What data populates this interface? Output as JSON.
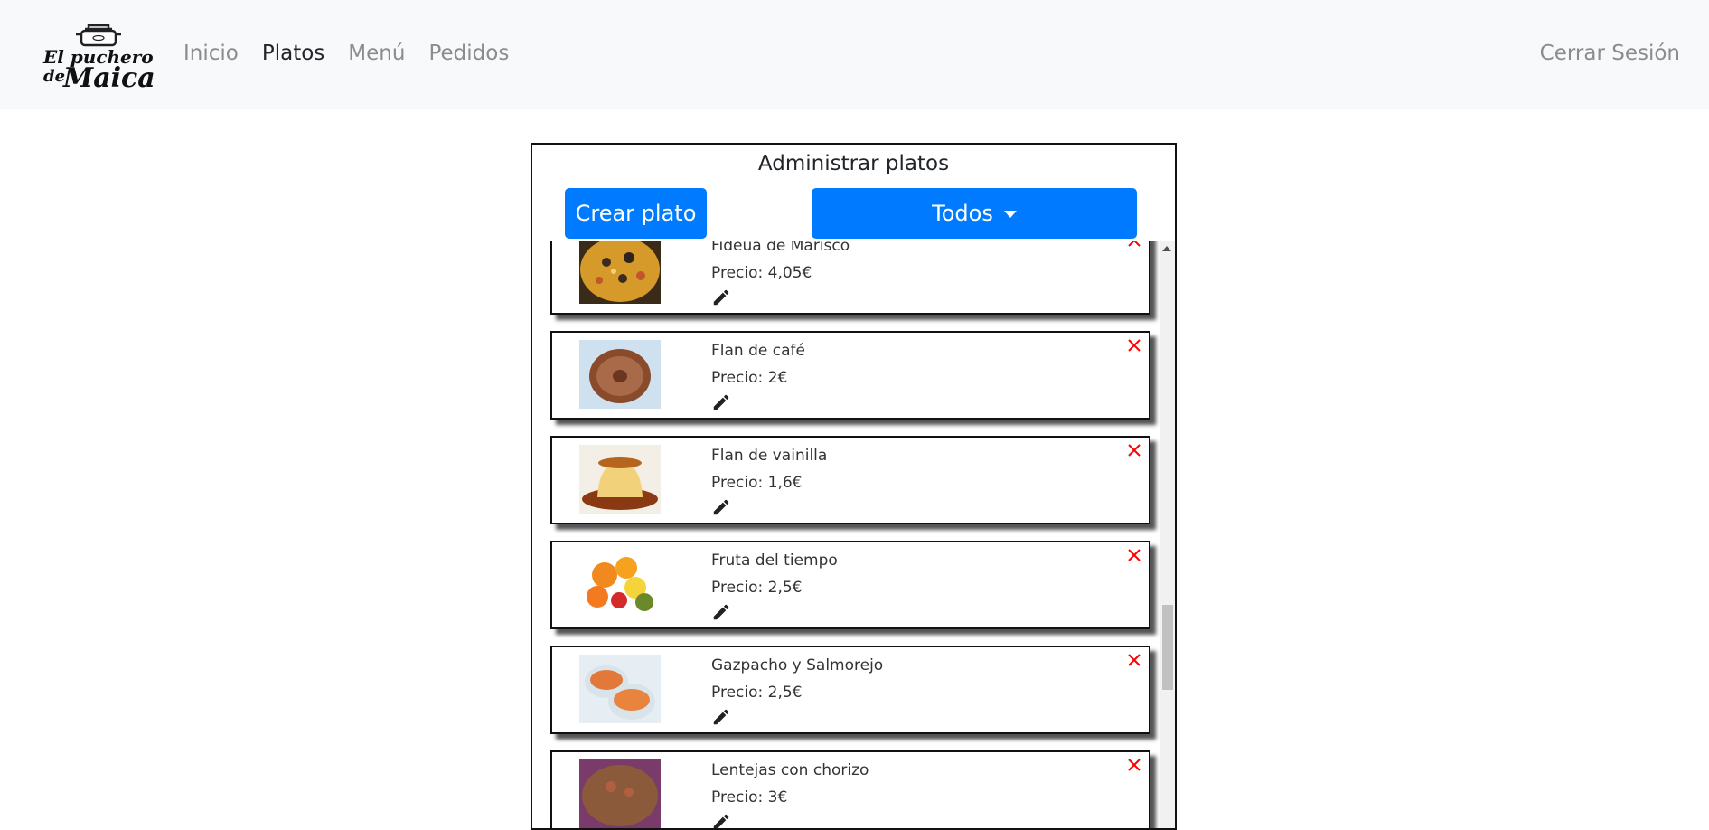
{
  "brand": {
    "logo_text": "El puchero de Maica"
  },
  "nav": {
    "links": [
      "Inicio",
      "Platos",
      "Menú",
      "Pedidos"
    ],
    "active": "Platos",
    "logout": "Cerrar Sesión"
  },
  "panel": {
    "title": "Administrar platos",
    "create_button": "Crear plato",
    "filter_button": "Todos"
  },
  "dishes": [
    {
      "name": "Fideua de Marisco",
      "price_label": "Precio:",
      "price": "4,05€"
    },
    {
      "name": "Flan de café",
      "price_label": "Precio:",
      "price": "2€"
    },
    {
      "name": "Flan de vainilla",
      "price_label": "Precio:",
      "price": "1,6€"
    },
    {
      "name": "Fruta del tiempo",
      "price_label": "Precio:",
      "price": "2,5€"
    },
    {
      "name": "Gazpacho y Salmorejo",
      "price_label": "Precio:",
      "price": "2,5€"
    },
    {
      "name": "Lentejas con chorizo",
      "price_label": "Precio:",
      "price": "3€"
    }
  ],
  "icons": {
    "edit": "pencil-icon",
    "delete": "close-icon"
  },
  "colors": {
    "primary": "#007bff",
    "delete": "#ff0000",
    "navbar_bg": "#f8f9fa"
  }
}
